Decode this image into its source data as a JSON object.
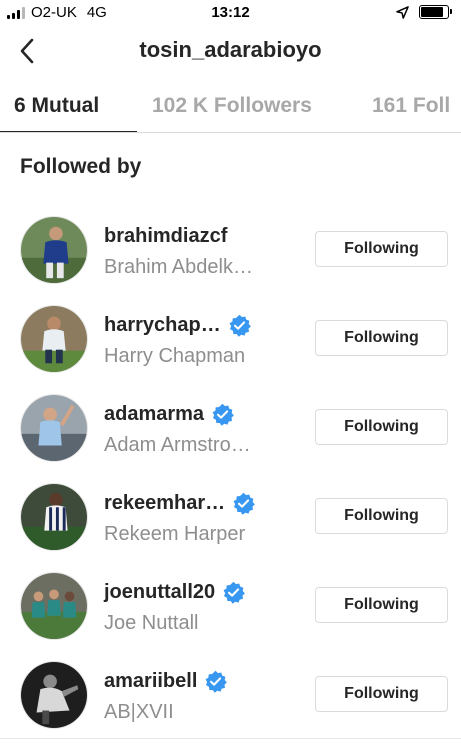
{
  "status_bar": {
    "carrier": "O2-UK",
    "network": "4G",
    "time": "13:12",
    "battery_level": 0.85
  },
  "header": {
    "title": "tosin_adarabioyo"
  },
  "tabs": [
    {
      "label": "6 Mutual",
      "active": true
    },
    {
      "label": "102 K Followers",
      "active": false
    },
    {
      "label": "161 Foll",
      "active": false
    }
  ],
  "section": {
    "title": "Followed by"
  },
  "users": [
    {
      "username": "brahimdiazcf",
      "full_name": "Brahim Abdelk…",
      "verified": false,
      "button": "Following"
    },
    {
      "username": "harrychap…",
      "full_name": "Harry Chapman",
      "verified": true,
      "button": "Following"
    },
    {
      "username": "adamarma",
      "full_name": "Adam Armstro…",
      "verified": true,
      "button": "Following"
    },
    {
      "username": "rekeemhar…",
      "full_name": "Rekeem Harper",
      "verified": true,
      "button": "Following"
    },
    {
      "username": "joenuttall20",
      "full_name": "Joe Nuttall",
      "verified": true,
      "button": "Following"
    },
    {
      "username": "amariibell",
      "full_name": "AB|XVII",
      "verified": true,
      "button": "Following"
    }
  ],
  "colors": {
    "verified_blue": "#3897f0",
    "muted_text": "#8e8e8e",
    "border": "#dbdbdb",
    "text": "#262626"
  }
}
